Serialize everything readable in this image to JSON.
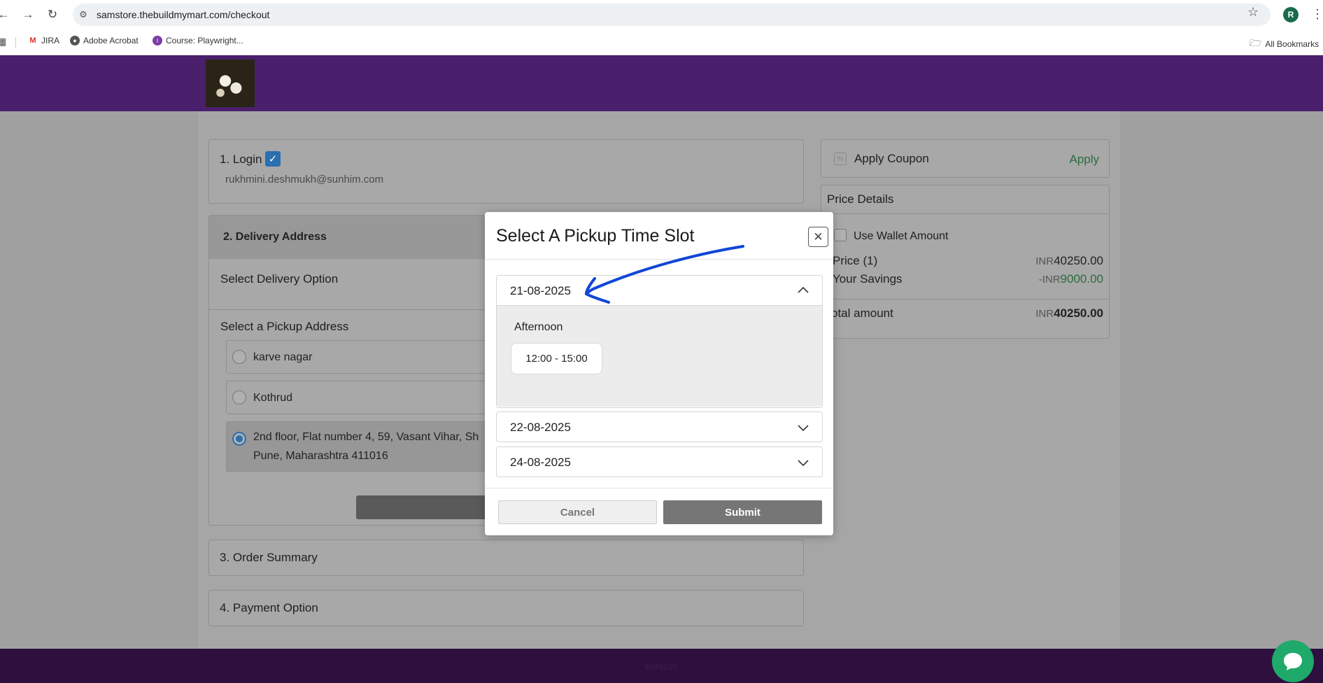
{
  "browser": {
    "url": "samstore.thebuildmymart.com/checkout",
    "profile_initial": "R",
    "bookmarks": [
      {
        "label": "JIRA",
        "icon": "jira-icon"
      },
      {
        "label": "Adobe Acrobat",
        "icon": "acrobat-icon"
      },
      {
        "label": "Course: Playwright...",
        "icon": "course-icon"
      }
    ],
    "all_bookmarks": "All Bookmarks"
  },
  "checkout": {
    "login": {
      "title": "1. Login",
      "email": "rukhmini.deshmukh@sunhim.com"
    },
    "delivery": {
      "title": "2. Delivery Address",
      "option_label": "Select Delivery Option",
      "pickup_label": "Select a Pickup Address",
      "addresses": [
        {
          "line1": "karve nagar",
          "line2": "",
          "selected": false
        },
        {
          "line1": "Kothrud",
          "line2": "",
          "selected": false
        },
        {
          "line1": "2nd floor, Flat number 4, 59, Vasant Vihar, Sh",
          "line2": "Pune, Maharashtra 411016",
          "selected": true
        }
      ]
    },
    "order_summary": "3. Order Summary",
    "payment_option": "4. Payment Option"
  },
  "sidebar": {
    "coupon_label": "Apply Coupon",
    "apply_link": "Apply",
    "price_details_title": "Price Details",
    "wallet_label": "Use Wallet Amount",
    "price_label": "Price (1)",
    "price_currency": "INR",
    "price_value": "40250.00",
    "savings_label": "Your Savings",
    "savings_currency": "-INR",
    "savings_value": "9000.00",
    "total_label": "otal amount",
    "total_currency": "INR",
    "total_value": "40250.00"
  },
  "footer": {
    "text": "kuhduh"
  },
  "modal": {
    "title": "Select A Pickup Time Slot",
    "dates": [
      {
        "date": "21-08-2025",
        "expanded": true
      },
      {
        "date": "22-08-2025",
        "expanded": false
      },
      {
        "date": "24-08-2025",
        "expanded": false
      }
    ],
    "period": "Afternoon",
    "slot": "12:00 - 15:00",
    "cancel": "Cancel",
    "submit": "Submit"
  },
  "colors": {
    "header": "#4a1f6c",
    "footer": "#2e0f3e",
    "apply": "#2a6d3e",
    "chat": "#1fa96a",
    "annotation": "#1147d6"
  }
}
